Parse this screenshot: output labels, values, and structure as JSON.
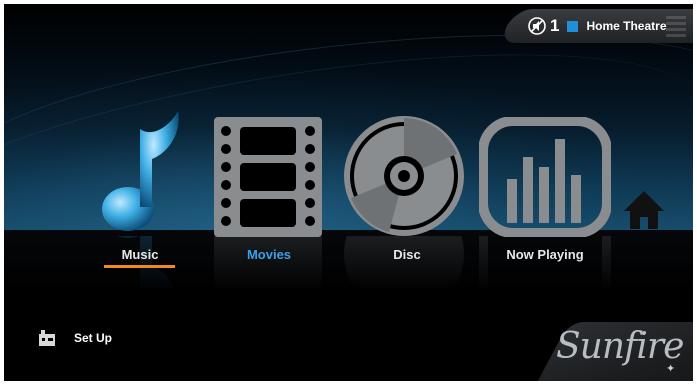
{
  "status": {
    "zone_number": "1",
    "zone_name": "Home Theatre",
    "zone_color": "#1f8fd6",
    "icon": "speaker-icon"
  },
  "menu": {
    "items": [
      {
        "label": "Music",
        "icon": "music-note-icon",
        "active": false,
        "focused": true
      },
      {
        "label": "Movies",
        "icon": "film-strip-icon",
        "active": true,
        "focused": false
      },
      {
        "label": "Disc",
        "icon": "disc-icon",
        "active": false,
        "focused": false
      },
      {
        "label": "Now Playing",
        "icon": "equalizer-icon",
        "active": false,
        "focused": false
      }
    ],
    "focus_color": "#f08a1f",
    "active_color": "#3aa0e8",
    "home_icon": "home-icon"
  },
  "setup": {
    "label": "Set Up",
    "icon": "settings-icon"
  },
  "brand": {
    "name": "Sunfire"
  }
}
